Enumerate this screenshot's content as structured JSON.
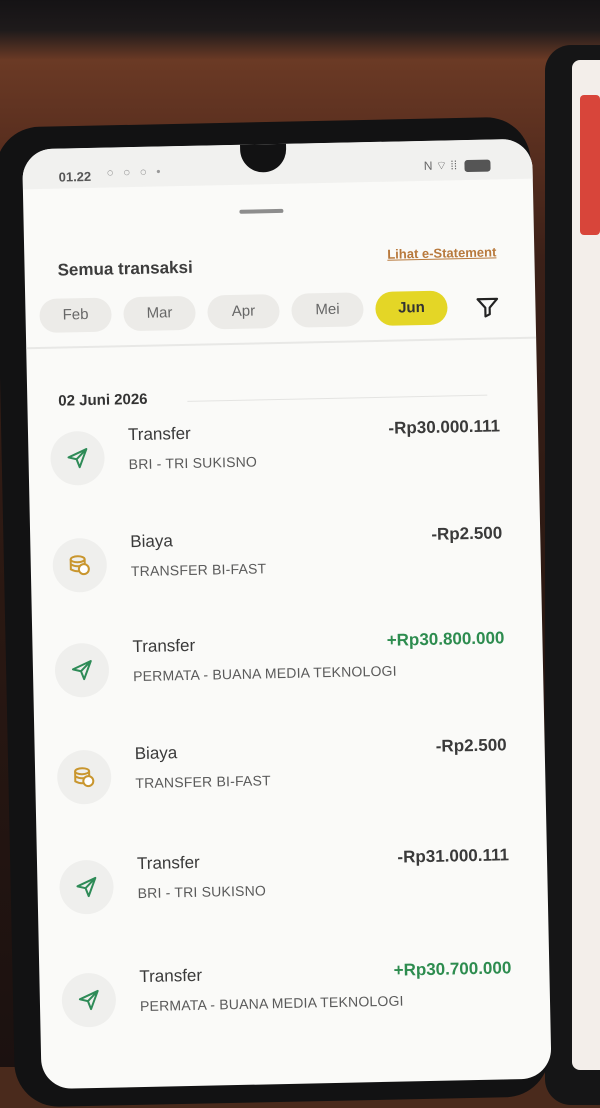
{
  "status_bar": {
    "time": "01.22",
    "notification_dots": "○ ○ ○ •",
    "signal_text": "N ⌔ ⁞⁞",
    "battery": "77"
  },
  "header": {
    "title": "Semua transaksi",
    "estatement_link": "Lihat e-Statement"
  },
  "months": [
    {
      "label": "Feb",
      "active": false
    },
    {
      "label": "Mar",
      "active": false
    },
    {
      "label": "Apr",
      "active": false
    },
    {
      "label": "Mei",
      "active": false
    },
    {
      "label": "Jun",
      "active": true
    }
  ],
  "date_group": "02 Juni 2026",
  "transactions": [
    {
      "icon": "paper-plane-icon",
      "title": "Transfer",
      "subtitle": "BRI - TRI SUKISNO",
      "amount": "-Rp30.000.111",
      "type": "debit"
    },
    {
      "icon": "coins-icon",
      "title": "Biaya",
      "subtitle": "TRANSFER BI-FAST",
      "amount": "-Rp2.500",
      "type": "debit"
    },
    {
      "icon": "paper-plane-icon",
      "title": "Transfer",
      "subtitle": "PERMATA - BUANA MEDIA TEKNOLOGI",
      "amount": "+Rp30.800.000",
      "type": "credit"
    },
    {
      "icon": "coins-icon",
      "title": "Biaya",
      "subtitle": "TRANSFER BI-FAST",
      "amount": "-Rp2.500",
      "type": "debit"
    },
    {
      "icon": "paper-plane-icon",
      "title": "Transfer",
      "subtitle": "BRI - TRI SUKISNO",
      "amount": "-Rp31.000.111",
      "type": "debit"
    },
    {
      "icon": "paper-plane-icon",
      "title": "Transfer",
      "subtitle": "PERMATA - BUANA MEDIA TEKNOLOGI",
      "amount": "+Rp30.700.000",
      "type": "credit"
    }
  ],
  "colors": {
    "accent_yellow": "#e4d626",
    "credit_green": "#2d8c4f",
    "icon_green": "#2e8b57",
    "icon_gold": "#c9962e",
    "link_orange": "#b8793c"
  }
}
